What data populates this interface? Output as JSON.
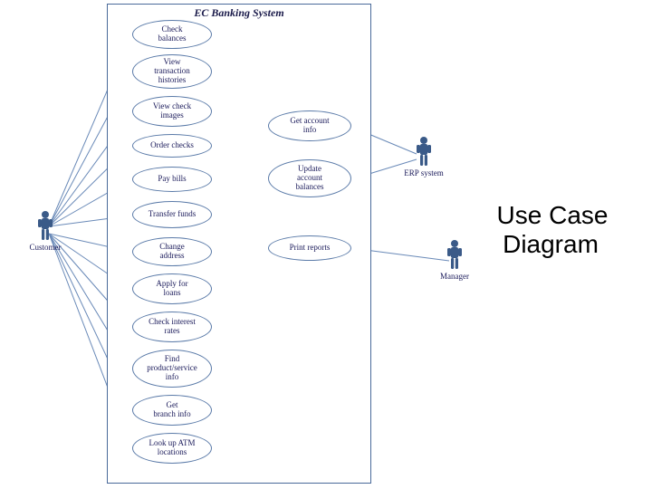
{
  "diagram": {
    "system_name": "EC Banking System",
    "title_line1": "Use Case",
    "title_line2": "Diagram",
    "actors": {
      "customer": "Customer",
      "erp": "ERP system",
      "manager": "Manager"
    },
    "usecases": {
      "check_balances": "Check\nbalances",
      "view_transaction_histories": "View\ntransaction\nhistories",
      "view_check_images": "View check\nimages",
      "order_checks": "Order checks",
      "pay_bills": "Pay bills",
      "transfer_funds": "Transfer funds",
      "change_address": "Change\naddress",
      "apply_for_loans": "Apply for\nloans",
      "check_interest_rates": "Check interest\nrates",
      "find_product_service_info": "Find\nproduct/service\ninfo",
      "get_branch_info": "Get\nbranch info",
      "look_up_atm_locations": "Look up ATM\nlocations",
      "get_account_info": "Get account\ninfo",
      "update_account_balances": "Update\naccount\nbalances",
      "print_reports": "Print reports"
    }
  },
  "chart_data": {
    "type": "uml-use-case",
    "system": "EC Banking System",
    "actors": [
      "Customer",
      "ERP system",
      "Manager"
    ],
    "use_cases": [
      "Check balances",
      "View transaction histories",
      "View check images",
      "Order checks",
      "Pay bills",
      "Transfer funds",
      "Change address",
      "Apply for loans",
      "Check interest rates",
      "Find product/service info",
      "Get branch info",
      "Look up ATM locations",
      "Get account info",
      "Update account balances",
      "Print reports"
    ],
    "associations": [
      {
        "actor": "Customer",
        "use_case": "Check balances"
      },
      {
        "actor": "Customer",
        "use_case": "View transaction histories"
      },
      {
        "actor": "Customer",
        "use_case": "View check images"
      },
      {
        "actor": "Customer",
        "use_case": "Order checks"
      },
      {
        "actor": "Customer",
        "use_case": "Pay bills"
      },
      {
        "actor": "Customer",
        "use_case": "Transfer funds"
      },
      {
        "actor": "Customer",
        "use_case": "Change address"
      },
      {
        "actor": "Customer",
        "use_case": "Apply for loans"
      },
      {
        "actor": "Customer",
        "use_case": "Check interest rates"
      },
      {
        "actor": "Customer",
        "use_case": "Find product/service info"
      },
      {
        "actor": "Customer",
        "use_case": "Get branch info"
      },
      {
        "actor": "Customer",
        "use_case": "Look up ATM locations"
      },
      {
        "actor": "ERP system",
        "use_case": "Get account info"
      },
      {
        "actor": "ERP system",
        "use_case": "Update account balances"
      },
      {
        "actor": "Manager",
        "use_case": "Print reports"
      }
    ]
  }
}
